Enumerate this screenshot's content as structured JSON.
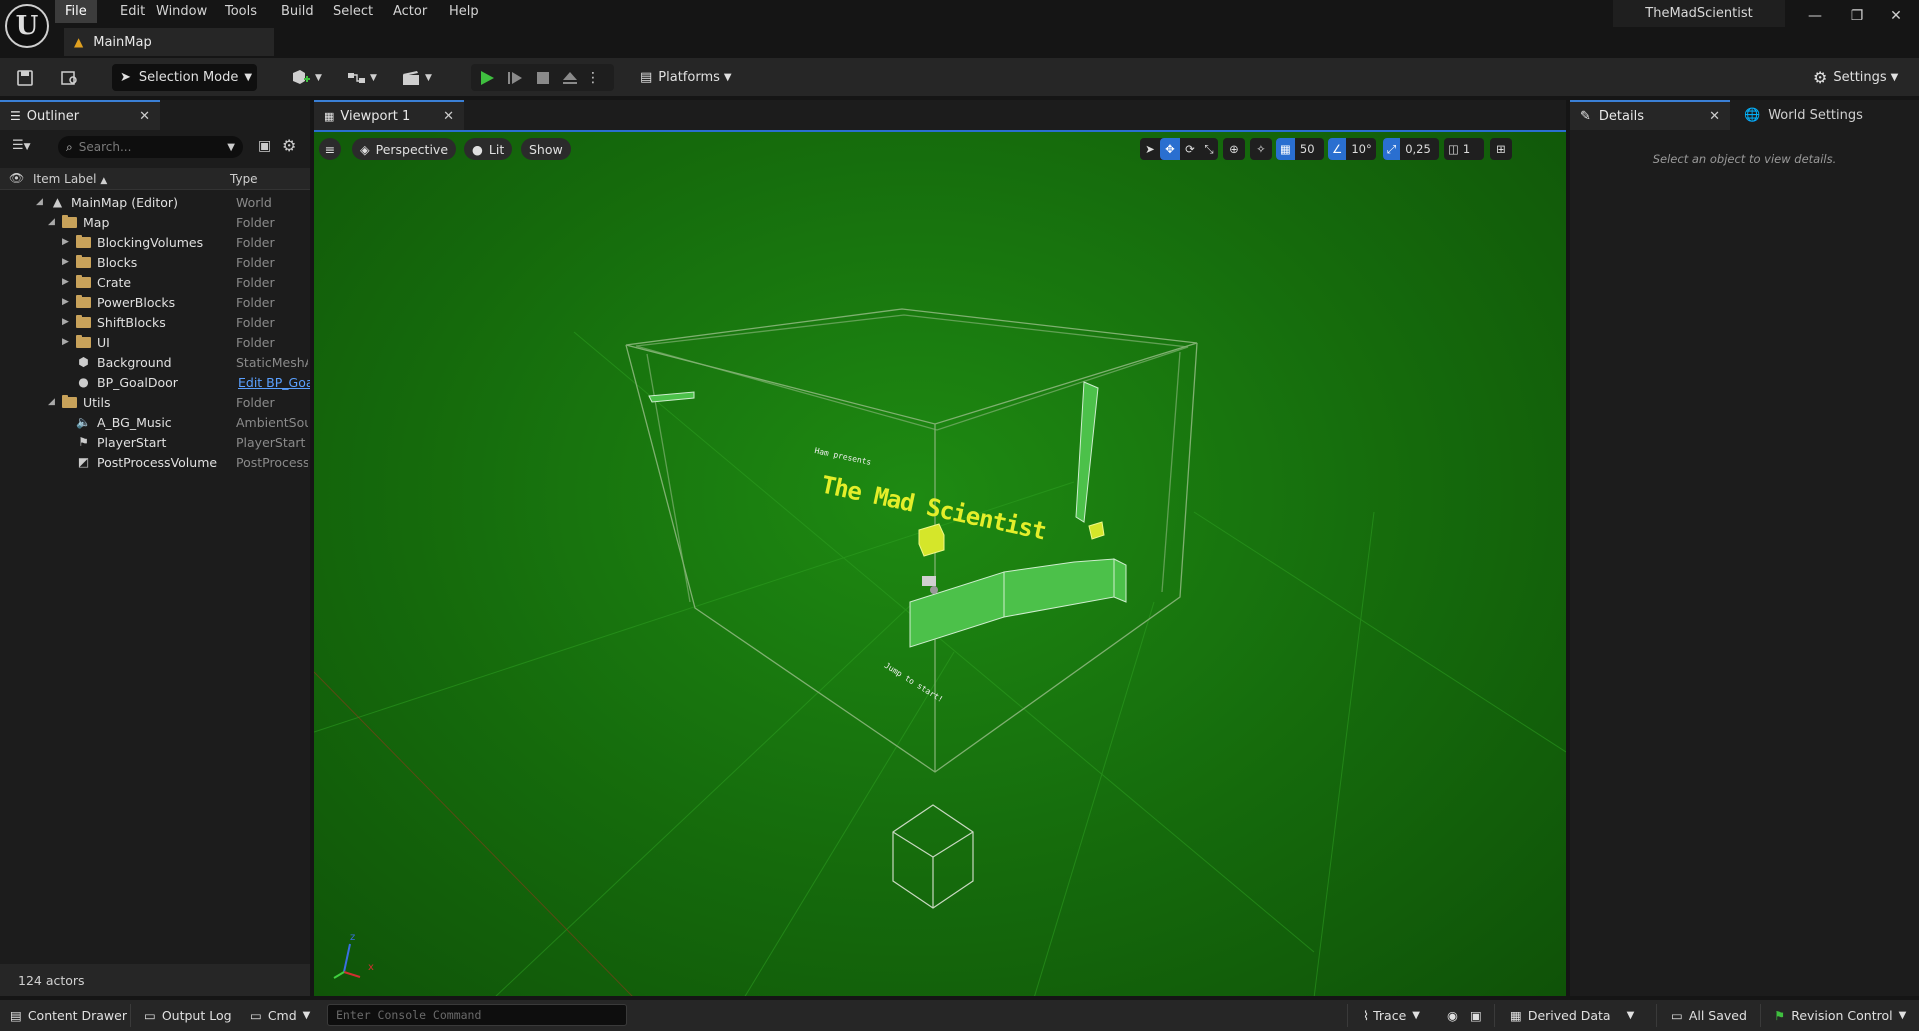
{
  "menu": {
    "items": [
      "File",
      "Edit",
      "Window",
      "Tools",
      "Build",
      "Select",
      "Actor",
      "Help"
    ],
    "active_index": 0
  },
  "document_tab": "MainMap",
  "project_name": "TheMadScientist",
  "toolbar": {
    "selection_mode": "Selection Mode",
    "platforms": "Platforms",
    "settings": "Settings"
  },
  "outliner": {
    "tab_label": "Outliner",
    "search_placeholder": "Search...",
    "col_label": "Item Label",
    "col_type": "Type",
    "rows": [
      {
        "label": "MainMap (Editor)",
        "type": "World"
      },
      {
        "label": "Map",
        "type": "Folder"
      },
      {
        "label": "BlockingVolumes",
        "type": "Folder"
      },
      {
        "label": "Blocks",
        "type": "Folder"
      },
      {
        "label": "Crate",
        "type": "Folder"
      },
      {
        "label": "PowerBlocks",
        "type": "Folder"
      },
      {
        "label": "ShiftBlocks",
        "type": "Folder"
      },
      {
        "label": "UI",
        "type": "Folder"
      },
      {
        "label": "Background",
        "type": "StaticMeshA"
      },
      {
        "label": "BP_GoalDoor",
        "type": "Edit BP_Goa"
      },
      {
        "label": "Utils",
        "type": "Folder"
      },
      {
        "label": "A_BG_Music",
        "type": "AmbientSour"
      },
      {
        "label": "PlayerStart",
        "type": "PlayerStart"
      },
      {
        "label": "PostProcessVolume",
        "type": "PostProcess"
      }
    ],
    "actor_count": "124 actors"
  },
  "viewport": {
    "tab_label": "Viewport 1",
    "perspective": "Perspective",
    "lit": "Lit",
    "show": "Show",
    "grid_snap": "50",
    "rot_snap": "10°",
    "scale_snap": "0,25",
    "camera_speed": "1",
    "scene_texts": {
      "presents": "Ham presents",
      "title": "The Mad Scientist",
      "jump": "Jump to start!"
    },
    "axis_x": "x",
    "axis_z": "z"
  },
  "details": {
    "tab_label": "Details",
    "world_settings": "World Settings",
    "empty_message": "Select an object to view details."
  },
  "statusbar": {
    "content_drawer": "Content Drawer",
    "output_log": "Output Log",
    "cmd": "Cmd",
    "console_placeholder": "Enter Console Command",
    "trace": "Trace",
    "derived_data": "Derived Data",
    "all_saved": "All Saved",
    "revision_control": "Revision Control"
  },
  "colors": {
    "accent": "#2a6fd0",
    "viewport_green": "#187a0e",
    "title_yellow": "#e4ee2a"
  }
}
